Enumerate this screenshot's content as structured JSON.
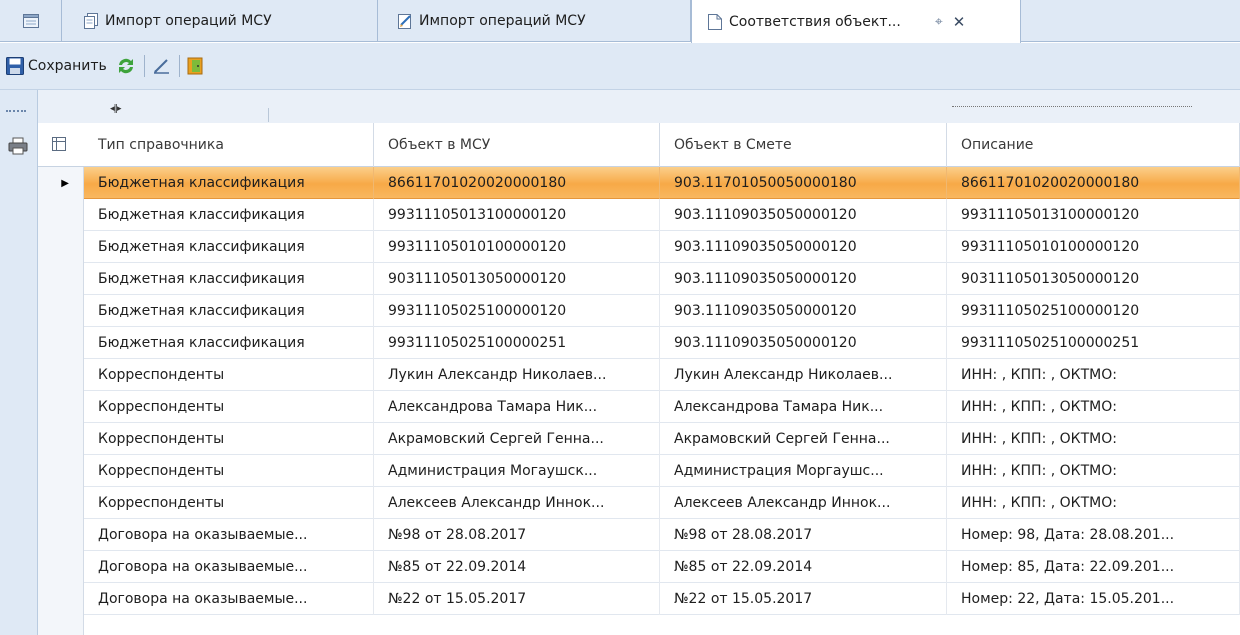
{
  "tabs": [
    {
      "label": ""
    },
    {
      "label": "Импорт операций МСУ"
    },
    {
      "label": "Импорт операций МСУ"
    },
    {
      "label": "Соответствия объект..."
    }
  ],
  "toolbar": {
    "save_label": "Сохранить"
  },
  "grid": {
    "columns": [
      "Тип справочника",
      "Объект в МСУ",
      "Объект в Смете",
      "Описание"
    ],
    "rows": [
      [
        "Бюджетная классификация",
        "86611701020020000180",
        "903.11701050050000180",
        "86611701020020000180"
      ],
      [
        "Бюджетная классификация",
        "99311105013100000120",
        "903.11109035050000120",
        "99311105013100000120"
      ],
      [
        "Бюджетная классификация",
        "99311105010100000120",
        "903.11109035050000120",
        "99311105010100000120"
      ],
      [
        "Бюджетная классификация",
        "90311105013050000120",
        "903.11109035050000120",
        "90311105013050000120"
      ],
      [
        "Бюджетная классификация",
        "99311105025100000120",
        "903.11109035050000120",
        "99311105025100000120"
      ],
      [
        "Бюджетная классификация",
        "99311105025100000251",
        "903.11109035050000120",
        "99311105025100000251"
      ],
      [
        "Корреспонденты",
        "Лукин Александр Николаев...",
        "Лукин Александр Николаев...",
        "ИНН: , КПП: , ОКТМО:"
      ],
      [
        "Корреспонденты",
        "Александрова Тамара Ник...",
        "Александрова Тамара Ник...",
        "ИНН: , КПП: , ОКТМО:"
      ],
      [
        "Корреспонденты",
        "Акрамовский Сергей Генна...",
        "Акрамовский Сергей Генна...",
        "ИНН: , КПП: , ОКТМО:"
      ],
      [
        "Корреспонденты",
        "Администрация Могаушск...",
        "Администрация Моргаушс...",
        "ИНН: , КПП: , ОКТМО:"
      ],
      [
        "Корреспонденты",
        "Алексеев Александр Иннок...",
        "Алексеев Александр Иннок...",
        "ИНН: , КПП: , ОКТМО:"
      ],
      [
        "Договора на оказываемые...",
        "№98 от 28.08.2017",
        "№98 от 28.08.2017",
        "Номер: 98, Дата: 28.08.201..."
      ],
      [
        "Договора на оказываемые...",
        "№85 от 22.09.2014",
        "№85 от 22.09.2014",
        "Номер: 85, Дата: 22.09.201..."
      ],
      [
        "Договора на оказываемые...",
        "№22 от 15.05.2017",
        "№22 от 15.05.2017",
        "Номер: 22, Дата: 15.05.201..."
      ]
    ],
    "selected_row": 0
  },
  "colors": {
    "accent_selected": "#f7a947",
    "chrome": "#dfe9f5"
  }
}
